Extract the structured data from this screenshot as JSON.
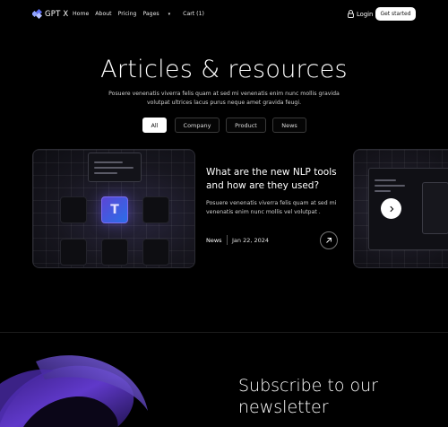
{
  "nav": {
    "logo_text": "GPT X",
    "items": [
      {
        "label": "Home"
      },
      {
        "label": "About"
      },
      {
        "label": "Pricing"
      },
      {
        "label": "Pages"
      },
      {
        "label": "Cart (1)"
      }
    ],
    "pages_caret": "▾",
    "login_label": "Login",
    "cta_label": "Get started"
  },
  "hero": {
    "title": "Articles & resources",
    "subtitle": "Posuere venenatis viverra felis quam at sed mi venenatis enim nunc mollis gravida volutpat ultrices lacus purus neque amet gravida feugi."
  },
  "filters": [
    {
      "label": "All",
      "active": true
    },
    {
      "label": "Company",
      "active": false
    },
    {
      "label": "Product",
      "active": false
    },
    {
      "label": "News",
      "active": false
    }
  ],
  "featured_article": {
    "title": "What are the new NLP tools and how are they used?",
    "description": "Posuere venenatis viverra felis quam at sed mi venenatis enim nunc mollis vel volutpat .",
    "tag": "News",
    "date": "Jan 22, 2024",
    "thumbnail_letter": "T"
  },
  "newsletter": {
    "title": "Subscribe to our newsletter"
  },
  "colors": {
    "background": "#000000",
    "accent_purple": "#5b46d6",
    "cta_bg": "#ffffff"
  },
  "icons": {
    "logo": "logo-icon",
    "login": "lock-icon",
    "article_link": "arrow-up-right-icon",
    "carousel_next": "chevron-right-icon"
  }
}
